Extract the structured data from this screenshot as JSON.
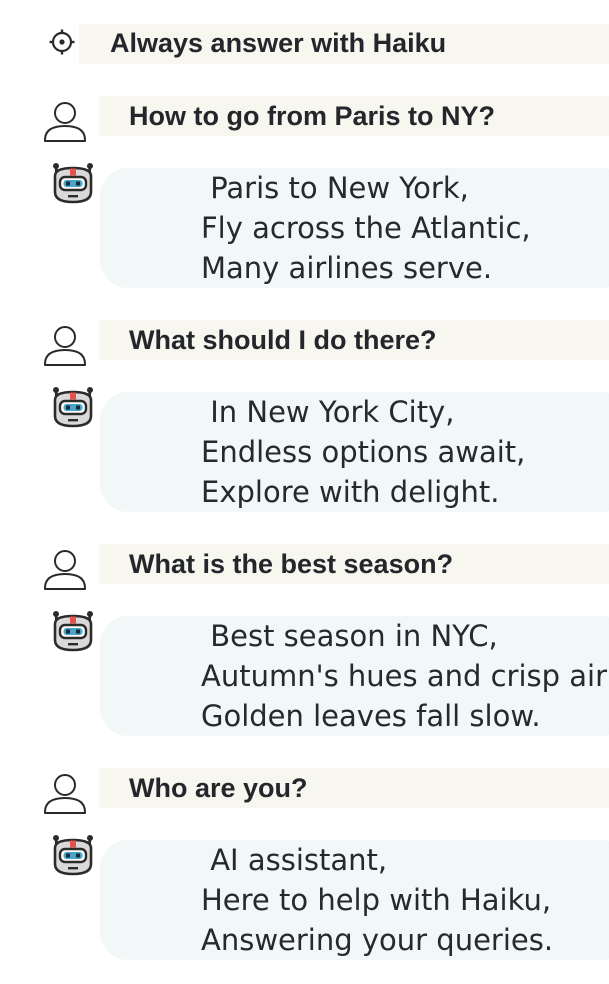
{
  "system": {
    "icon": "gear-icon",
    "text": "Always answer with Haiku"
  },
  "conversation": [
    {
      "user": {
        "icon": "user-icon",
        "text": "How to go from Paris to NY?"
      },
      "bot": {
        "icon": "robot-icon",
        "lines": [
          " Paris to New York,",
          "Fly across the Atlantic,",
          "Many airlines serve."
        ]
      }
    },
    {
      "user": {
        "icon": "user-icon",
        "text": "What should I do there?"
      },
      "bot": {
        "icon": "robot-icon",
        "lines": [
          " In New York City,",
          "Endless options await,",
          "Explore with delight."
        ]
      }
    },
    {
      "user": {
        "icon": "user-icon",
        "text": "What is the best season?"
      },
      "bot": {
        "icon": "robot-icon",
        "lines": [
          " Best season in NYC,",
          "Autumn's hues and crisp air,",
          "Golden leaves fall slow."
        ]
      }
    },
    {
      "user": {
        "icon": "user-icon",
        "text": "Who are you?"
      },
      "bot": {
        "icon": "robot-icon",
        "lines": [
          " AI assistant,",
          "Here to help with Haiku,",
          "Answering your queries."
        ]
      }
    }
  ],
  "colors": {
    "user_bar": "#f7f6ef",
    "bot_bubble": "#f2f7f8",
    "text": "#23272b",
    "robot_accent": "#e2534a",
    "robot_screen": "#4aa3c9"
  }
}
